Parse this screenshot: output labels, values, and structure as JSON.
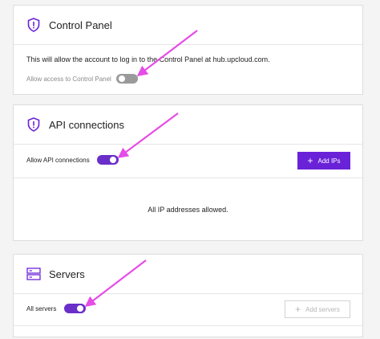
{
  "control_panel": {
    "title": "Control Panel",
    "icon": "shield-exclamation-icon",
    "description": "This will allow the account to log in to the Control Panel at hub.upcloud.com.",
    "toggle_label": "Allow access to Control Panel",
    "toggle_on": false
  },
  "api": {
    "title": "API connections",
    "icon": "shield-exclamation-icon",
    "toggle_label": "Allow API connections",
    "toggle_on": true,
    "add_ips_label": "Add IPs",
    "empty_message": "All IP addresses allowed."
  },
  "servers": {
    "title": "Servers",
    "icon": "server-icon",
    "toggle_label": "All servers",
    "toggle_on": true,
    "add_servers_label": "Add servers",
    "add_servers_disabled": true
  },
  "colors": {
    "accent": "#6a22d8",
    "annotation_arrow": "#e64ce6",
    "toggle_off": "#9a9a9a"
  }
}
